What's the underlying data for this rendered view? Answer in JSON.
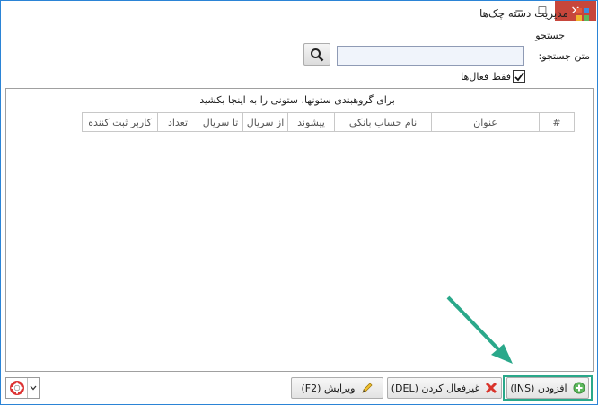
{
  "window": {
    "title": "مدیریت دسته چک‌ها",
    "minimize": "─",
    "maximize": "☐",
    "close": "✕"
  },
  "search": {
    "section_label": "جستجو",
    "text_label": "متن جستجو:",
    "value": "",
    "only_active_label": "فقط فعال‌ها",
    "only_active_checked": true
  },
  "grid": {
    "group_hint": "برای گروهبندی ستونها، ستونی را به اینجا بکشید",
    "columns": [
      "#",
      "عنوان",
      "نام حساب بانکی",
      "پیشوند",
      "از سریال",
      "تا سریال",
      "تعداد",
      "کاربر ثبت کننده"
    ]
  },
  "toolbar": {
    "add_label": "(INS) افزودن",
    "deactivate_label": "(DEL) غیرفعال کردن",
    "edit_label": "(F2) ویرایش"
  },
  "icons": {
    "app": "app-icon",
    "search": "magnifier-icon",
    "add": "plus-circle-icon",
    "deactivate": "red-x-icon",
    "edit": "pencil-icon",
    "help": "lifebuoy-icon",
    "dropdown": "chevron-down-icon"
  },
  "colors": {
    "close_button": "#c7463b",
    "highlight": "#2aa88a",
    "border": "#2b84d6"
  }
}
